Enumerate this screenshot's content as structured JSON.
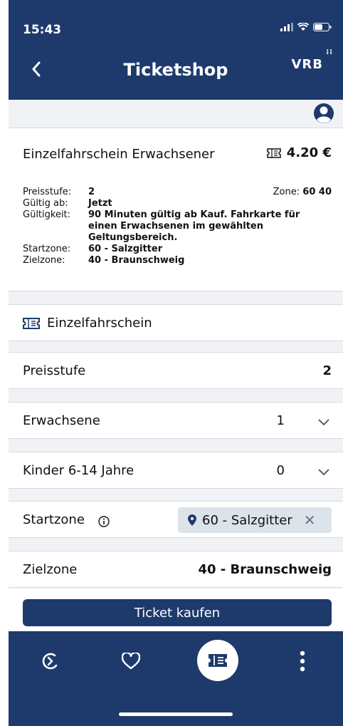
{
  "status_bar": {
    "time": "15:43",
    "signal_icon": "signal-icon",
    "wifi_icon": "wifi-icon",
    "battery_icon": "battery-icon"
  },
  "nav": {
    "back_icon": "chevron-left-icon",
    "title": "Ticketshop",
    "logo": "VRB"
  },
  "user_bar": {
    "icon": "user-circle-icon"
  },
  "ticket_info": {
    "title": "Einzelfahrschein Erwachsener",
    "price": "4.20 €",
    "zone_label": "Zone:",
    "zone_value": "60 40",
    "rows": [
      {
        "key": "Preisstufe:",
        "value": "2"
      },
      {
        "key": "Gültig ab:",
        "value": "Jetzt"
      },
      {
        "key": "Gültigkeit:",
        "value": "90 Minuten gültig ab Kauf. Fahrkarte für einen Erwachsenen im gewählten Geltungsbereich."
      },
      {
        "key": "Startzone:",
        "value": "60 - Salzgitter"
      },
      {
        "key": "Zielzone:",
        "value": "40 - Braunschweig"
      }
    ]
  },
  "ticket_type": {
    "label": "Einzelfahrschein"
  },
  "preisstufe": {
    "label": "Preisstufe",
    "value": "2"
  },
  "erwachsene": {
    "label": "Erwachsene",
    "value": "1"
  },
  "kinder": {
    "label": "Kinder 6-14 Jahre",
    "value": "0"
  },
  "startzone": {
    "label": "Startzone",
    "chip": "60 - Salzgitter",
    "remove": "✕"
  },
  "zielzone": {
    "label": "Zielzone",
    "value": "40 - Braunschweig"
  },
  "buy_button": "Ticket kaufen",
  "tabbar": {
    "items": [
      "route-icon",
      "heart-icon",
      "ticket-icon",
      "more-vertical-icon"
    ]
  },
  "colors": {
    "brand": "#1e3a6c",
    "chip": "#dde3ea",
    "background": "#f1f2f6"
  }
}
